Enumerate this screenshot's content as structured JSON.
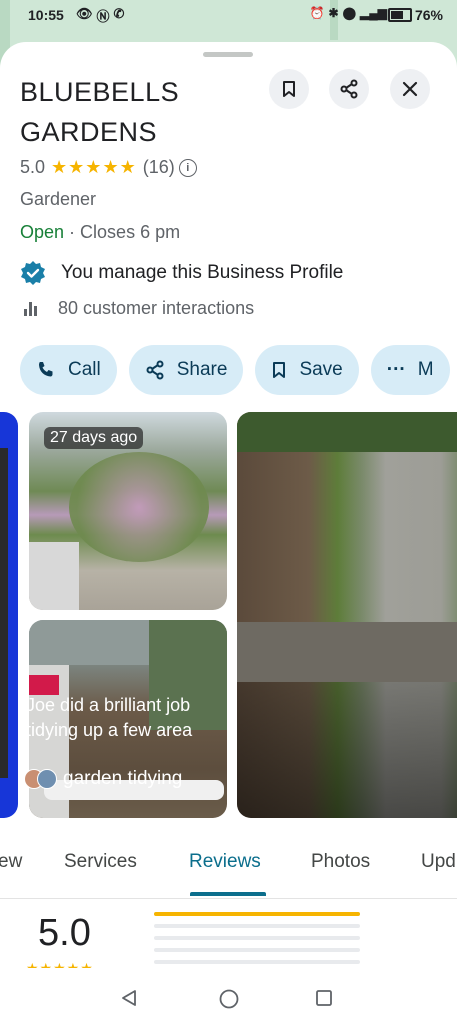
{
  "status_bar": {
    "time": "10:55",
    "battery": "76%",
    "battery_fraction": 0.76
  },
  "place": {
    "name": "BLUEBELLS GARDENS",
    "rating": "5.0",
    "review_count": "(16)",
    "stars": "★★★★★",
    "category": "Gardener",
    "open_status": "Open",
    "closing": " · Closes 6 pm",
    "manage_text": "You manage this Business Profile",
    "interactions": "80 customer interactions"
  },
  "header_buttons": {
    "save_icon": "bookmark-icon",
    "share_icon": "share-icon",
    "close_icon": "close-icon"
  },
  "actions": [
    {
      "label": "Call",
      "icon": "phone-icon"
    },
    {
      "label": "Share",
      "icon": "share-icon"
    },
    {
      "label": "Save",
      "icon": "bookmark-icon"
    },
    {
      "label": "M",
      "icon": "more-icon"
    }
  ],
  "photos": {
    "first_badge": "27 days ago",
    "review_line1": "Joe did a brilliant job",
    "review_line2": "tidying up a few area",
    "review_tag": "garden tidying"
  },
  "tabs": [
    "ew",
    "Services",
    "Reviews",
    "Photos",
    "Upd"
  ],
  "active_tab": "Reviews",
  "reviews_summary": {
    "score": "5.0",
    "stars": "★★★★★",
    "distribution": [
      1.0,
      0,
      0,
      0,
      0
    ]
  },
  "colors": {
    "accent": "#0b6e8c",
    "open_green": "#188038",
    "star": "#f6b400",
    "chip_bg": "#d7ecf7"
  }
}
